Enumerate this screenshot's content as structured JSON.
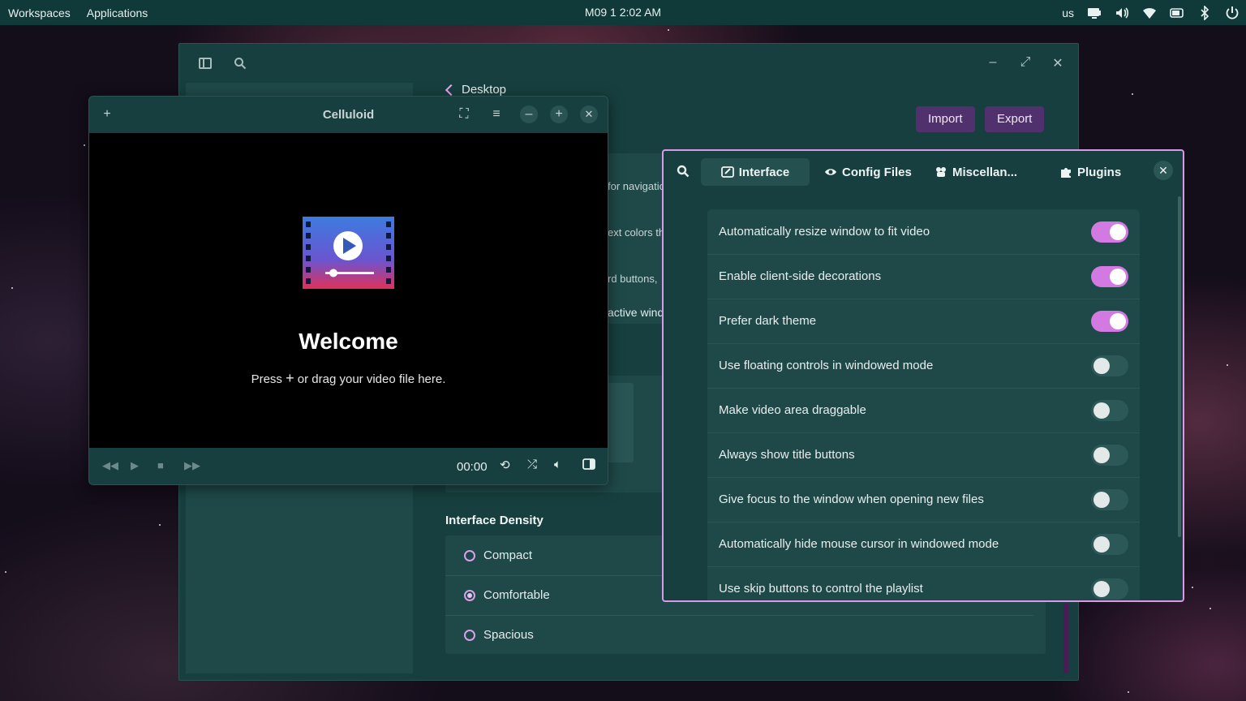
{
  "topbar": {
    "workspaces": "Workspaces",
    "applications": "Applications",
    "clock": "M09 1 2:02 AM",
    "keyboard_layout": "us",
    "tray_icons": [
      "display-icon",
      "volume-icon",
      "wifi-icon",
      "battery-icon",
      "bluetooth-icon",
      "power-icon"
    ]
  },
  "settings": {
    "back_label": "Desktop",
    "import_label": "Import",
    "export_label": "Export",
    "fragments": [
      "for navigatio",
      "ext colors tha",
      "rd buttons,",
      "active wind"
    ],
    "density": {
      "title": "Interface Density",
      "options": [
        {
          "label": "Compact",
          "checked": false
        },
        {
          "label": "Comfortable",
          "checked": true
        },
        {
          "label": "Spacious",
          "checked": false
        }
      ]
    }
  },
  "celluloid": {
    "title": "Celluloid",
    "welcome": "Welcome",
    "hint_before": "Press",
    "hint_plus": "+",
    "hint_after": "or drag your video file here.",
    "time": "00:00"
  },
  "preferences": {
    "tabs": [
      {
        "label": "Interface",
        "icon": "interface-icon",
        "active": true
      },
      {
        "label": "Config Files",
        "icon": "eye-icon",
        "active": false
      },
      {
        "label": "Miscellan...",
        "icon": "misc-icon",
        "active": false
      },
      {
        "label": "Plugins",
        "icon": "puzzle-icon",
        "active": false
      }
    ],
    "options": [
      {
        "label": "Automatically resize window to fit video",
        "on": true
      },
      {
        "label": "Enable client-side decorations",
        "on": true
      },
      {
        "label": "Prefer dark theme",
        "on": true
      },
      {
        "label": "Use floating controls in windowed mode",
        "on": false
      },
      {
        "label": "Make video area draggable",
        "on": false
      },
      {
        "label": "Always show title buttons",
        "on": false
      },
      {
        "label": "Give focus to the window when opening new files",
        "on": false
      },
      {
        "label": "Automatically hide mouse cursor in windowed mode",
        "on": false
      },
      {
        "label": "Use skip buttons to control the playlist",
        "on": false
      }
    ]
  },
  "colors": {
    "accent": "#d27ae2",
    "button_purple": "#51306e",
    "panel": "#173f3f",
    "topbar": "#103a3a"
  }
}
